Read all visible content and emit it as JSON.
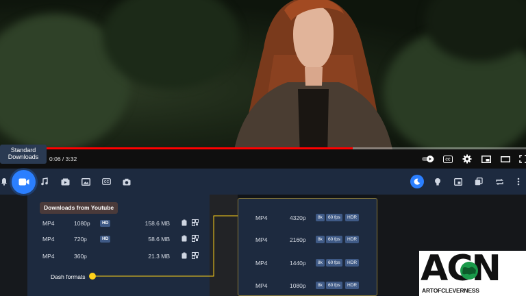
{
  "tooltip": {
    "line1": "Standard",
    "line2": "Downloads"
  },
  "player": {
    "time": "0:06 / 3:32",
    "progress": 0.67
  },
  "toolbar": {
    "left_icons": [
      "bell-icon",
      "video-camera-icon",
      "music-note-icon",
      "video-download-icon",
      "image-icon",
      "subtitles-icon",
      "camera-icon"
    ],
    "right_icons": [
      "moon-icon",
      "lightbulb-icon",
      "picture-in-picture-icon",
      "copy-icon",
      "repeat-icon",
      "more-icon"
    ]
  },
  "downloads": {
    "title": "Downloads from Youtube",
    "rows": [
      {
        "format": "MP4",
        "resolution": "1080p",
        "badge": "HD",
        "size": "158.6 MB"
      },
      {
        "format": "MP4",
        "resolution": "720p",
        "badge": "HD",
        "size": "58.6 MB"
      },
      {
        "format": "MP4",
        "resolution": "360p",
        "badge": "",
        "size": "21.3 MB"
      }
    ],
    "dash_label": "Dash formats"
  },
  "dash": {
    "rows": [
      {
        "format": "MP4",
        "resolution": "4320p",
        "tags": [
          "8k",
          "60 fps",
          "HDR"
        ]
      },
      {
        "format": "MP4",
        "resolution": "2160p",
        "tags": [
          "8k",
          "60 fps",
          "HDR"
        ]
      },
      {
        "format": "MP4",
        "resolution": "1440p",
        "tags": [
          "8k",
          "60 fps",
          "HDR"
        ]
      },
      {
        "format": "MP4",
        "resolution": "1080p",
        "tags": [
          "8k",
          "60 fps",
          "HDR"
        ]
      }
    ]
  },
  "logo": {
    "letters": "ACN",
    "subtitle": "ARTOFCLEVERNESS"
  },
  "colors": {
    "accent": "#2b7fff",
    "panel": "#1d2a3f",
    "dot": "#ffd11a",
    "chip": "#3f5a86"
  }
}
